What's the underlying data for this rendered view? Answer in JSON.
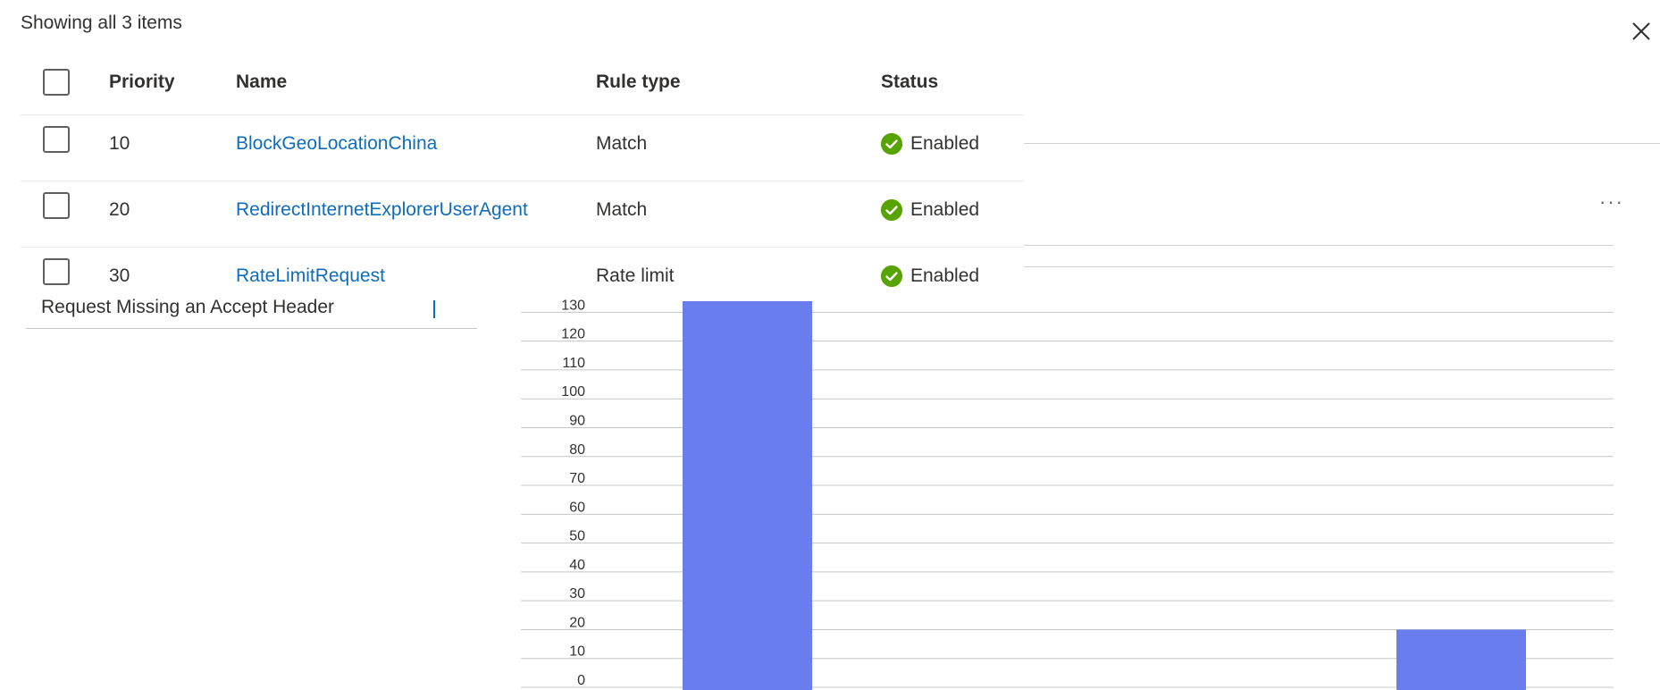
{
  "list": {
    "count_text": "Showing all 3 items",
    "columns": {
      "priority": "Priority",
      "name": "Name",
      "rule_type": "Rule type",
      "status": "Status"
    },
    "rows": [
      {
        "priority": "10",
        "name": "BlockGeoLocationChina",
        "rule_type": "Match",
        "status": "Enabled"
      },
      {
        "priority": "20",
        "name": "RedirectInternetExplorerUserAgent",
        "rule_type": "Match",
        "status": "Enabled"
      },
      {
        "priority": "30",
        "name": "RateLimitRequest",
        "rule_type": "Rate limit",
        "status": "Enabled"
      }
    ],
    "status_color": "#57a300",
    "link_color": "#0f6cbd"
  },
  "panel": {
    "close_icon": "close-icon",
    "more_icon": "more-options-icon",
    "more_label": "···"
  },
  "legend": {
    "item": "Request Missing an Accept Header"
  },
  "chart_data": {
    "type": "bar",
    "title": "",
    "xlabel": "",
    "ylabel": "",
    "ylim": [
      0,
      130
    ],
    "yticks": [
      0,
      10,
      20,
      30,
      40,
      50,
      60,
      70,
      80,
      90,
      100,
      110,
      120,
      130
    ],
    "categories": [
      "",
      ""
    ],
    "series": [
      {
        "name": "Request Missing an Accept Header",
        "values": [
          135,
          20
        ],
        "color": "#6a7def"
      }
    ],
    "grid": true
  }
}
